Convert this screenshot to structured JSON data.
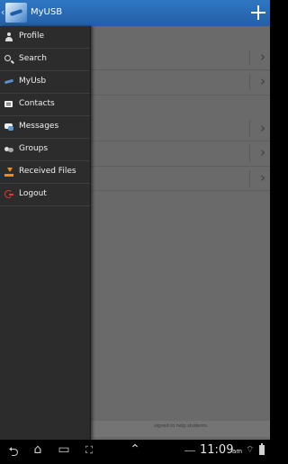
{
  "app": {
    "title": "MyUSB"
  },
  "drawer": {
    "items": [
      {
        "label": "Profile",
        "icon": "person-icon"
      },
      {
        "label": "Search",
        "icon": "search-icon"
      },
      {
        "label": "MyUsb",
        "icon": "myusb-icon"
      },
      {
        "label": "Contacts",
        "icon": "contacts-icon"
      },
      {
        "label": "Messages",
        "icon": "messages-icon"
      },
      {
        "label": "Groups",
        "icon": "groups-icon"
      },
      {
        "label": "Received Files",
        "icon": "download-icon"
      },
      {
        "label": "Logout",
        "icon": "logout-icon"
      }
    ]
  },
  "main": {
    "chevron": "›",
    "footer_text": "signed to help students"
  },
  "system_bar": {
    "clock": "11:09",
    "ampm": "am",
    "back_icon": "⮌",
    "home_icon": "⌂",
    "recents_icon": "▭",
    "screenshot_icon": "⛶",
    "up_icon": "⌃"
  },
  "colors": {
    "action_bar": "#2f76c2",
    "drawer_bg": "#2c2c2c",
    "dim_overlay": "#6a6a6a"
  }
}
